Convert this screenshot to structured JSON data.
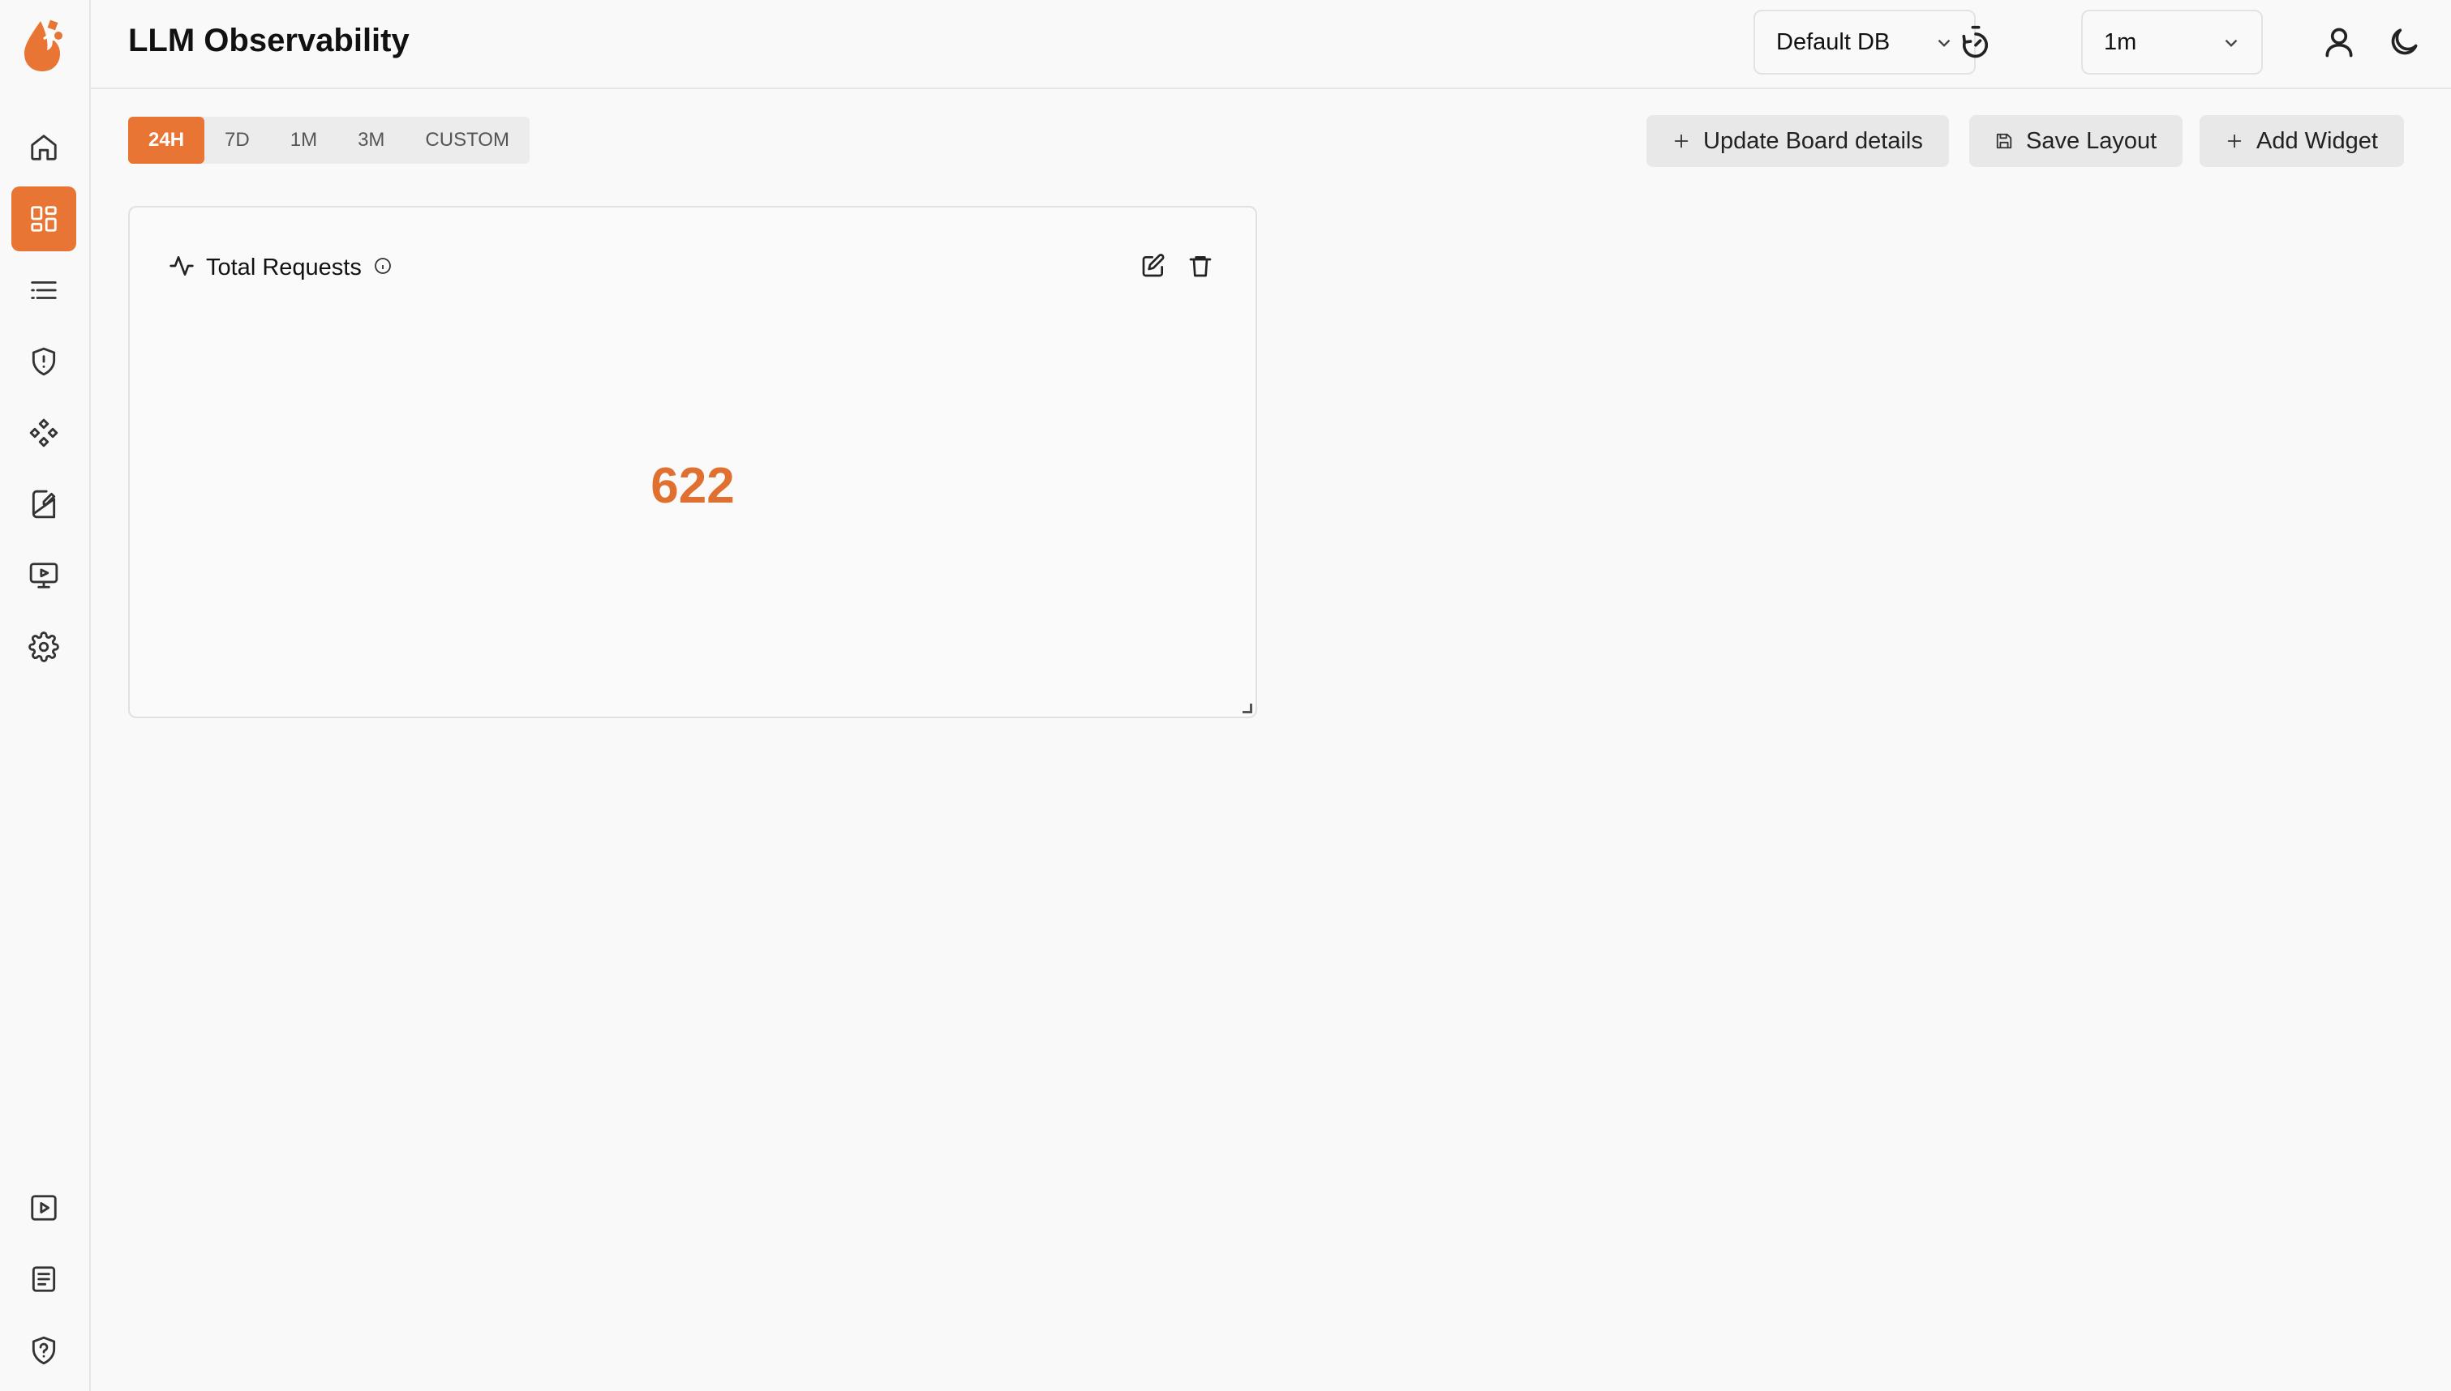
{
  "header": {
    "title": "LLM Observability",
    "db_select": "Default DB",
    "refresh_select": "1m"
  },
  "toolbar": {
    "ranges": [
      "24H",
      "7D",
      "1M",
      "3M",
      "CUSTOM"
    ],
    "active_range": "24H",
    "update_board_label": "Update Board details",
    "save_layout_label": "Save Layout",
    "add_widget_label": "Add Widget"
  },
  "widget": {
    "title": "Total Requests",
    "value": "622"
  },
  "colors": {
    "accent": "#e87533",
    "value": "#e07030"
  },
  "sidebar": {
    "items": [
      "home-icon",
      "dashboard-icon",
      "list-icon",
      "shield-alert-icon",
      "components-icon",
      "prompt-icon",
      "monitor-play-icon",
      "settings-icon"
    ],
    "bottom_items": [
      "video-icon",
      "docs-icon",
      "shield-help-icon"
    ]
  }
}
